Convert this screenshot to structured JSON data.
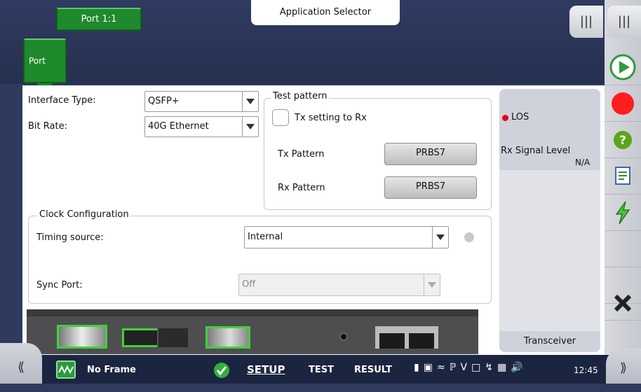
{
  "header": {
    "port_tab": "Port 1:1",
    "app_selector": "Application Selector",
    "port_button": "Port"
  },
  "port_settings": {
    "interface_type_label": "Interface Type:",
    "interface_type_value": "QSFP+",
    "bit_rate_label": "Bit Rate:",
    "bit_rate_value": "40G Ethernet"
  },
  "test_pattern": {
    "legend": "Test pattern",
    "tx_to_rx_label": "Tx setting to Rx",
    "tx_to_rx_checked": false,
    "tx_pattern_label": "Tx Pattern",
    "tx_pattern_value": "PRBS7",
    "rx_pattern_label": "Rx Pattern",
    "rx_pattern_value": "PRBS7"
  },
  "clock": {
    "legend": "Clock Configuration",
    "timing_source_label": "Timing source:",
    "timing_source_value": "Internal",
    "sync_port_label": "Sync Port:",
    "sync_port_value": "Off"
  },
  "status": {
    "los_label": "LOS",
    "los_color": "#e8001c",
    "rx_signal_label": "Rx Signal Level",
    "rx_signal_value": "N/A",
    "transceiver_label": "Transceiver"
  },
  "right_toolbar": {
    "icons": [
      "menu-icon",
      "start-icon",
      "record-icon",
      "help-icon",
      "report-icon",
      "lightning-icon",
      "close-icon"
    ]
  },
  "bottom_bar": {
    "frame_status": "No Frame",
    "setup_tab": "SETUP",
    "test_tab": "TEST",
    "result_tab": "RESULT",
    "time": "12:45",
    "left_nav": "⟪",
    "right_nav": "⟫"
  },
  "colors": {
    "accent_green": "#1e8a2c",
    "background_navy": "#2e3a5e",
    "record_red": "#ff1e1e"
  }
}
